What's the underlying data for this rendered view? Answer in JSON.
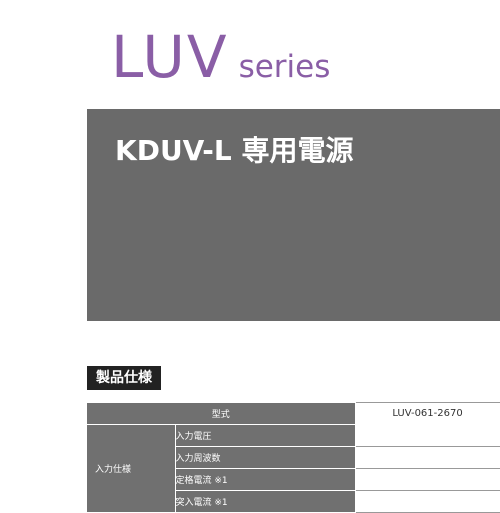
{
  "header": {
    "series_name": "LUV",
    "series_suffix": "series"
  },
  "banner": {
    "title": "KDUV-L 専用電源"
  },
  "section": {
    "heading": "製品仕様"
  },
  "spec_table": {
    "header_label": "型式",
    "model": "LUV-061-2670",
    "group_label": "入力仕様",
    "rows": [
      {
        "label": "入力電圧",
        "value": ""
      },
      {
        "label": "入力周波数",
        "value": ""
      },
      {
        "label": "定格電流 ※1",
        "value": ""
      },
      {
        "label": "突入電流 ※1",
        "value": ""
      }
    ]
  },
  "colors": {
    "accent_purple": "#8a5ea6",
    "banner_gray": "#6a6a6a",
    "table_gray": "#707070",
    "heading_black": "#222222"
  }
}
